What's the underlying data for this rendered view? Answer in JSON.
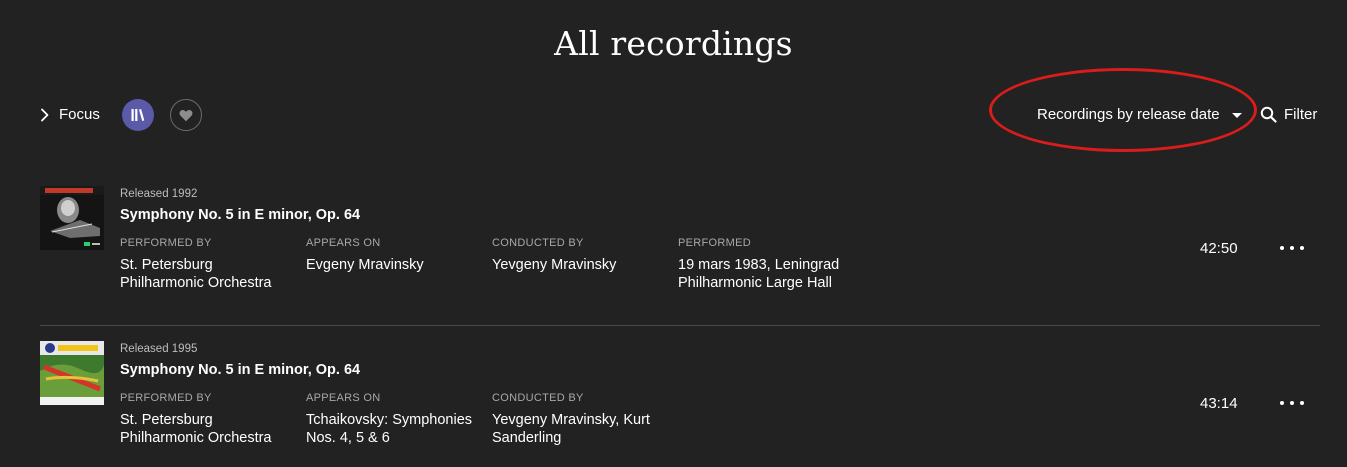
{
  "page": {
    "title": "All recordings"
  },
  "toolbar": {
    "focus_label": "Focus",
    "sort_label": "Recordings by release date",
    "filter_label": "Filter",
    "library_icon": "library-icon",
    "heart_icon": "heart-icon",
    "accent_color": "#5a5aa8",
    "highlight_color": "#d91c1c"
  },
  "recordings": [
    {
      "released": "Released 1992",
      "work": "Symphony No. 5 in E minor, Op. 64",
      "performed_by_label": "PERFORMED BY",
      "performed_by": "St. Petersburg Philharmonic Orchestra",
      "appears_on_label": "APPEARS ON",
      "appears_on": "Evgeny Mravinsky",
      "conducted_by_label": "CONDUCTED BY",
      "conducted_by": "Yevgeny Mravinsky",
      "performed_label": "PERFORMED",
      "performed": "19 mars 1983, Leningrad Philharmonic Large Hall",
      "duration": "42:50"
    },
    {
      "released": "Released 1995",
      "work": "Symphony No. 5 in E minor, Op. 64",
      "performed_by_label": "PERFORMED BY",
      "performed_by": "St. Petersburg Philharmonic Orchestra",
      "appears_on_label": "APPEARS ON",
      "appears_on": "Tchaikovsky: Symphonies Nos. 4, 5 & 6",
      "conducted_by_label": "CONDUCTED BY",
      "conducted_by": "Yevgeny Mravinsky, Kurt Sanderling",
      "duration": "43:14"
    }
  ]
}
